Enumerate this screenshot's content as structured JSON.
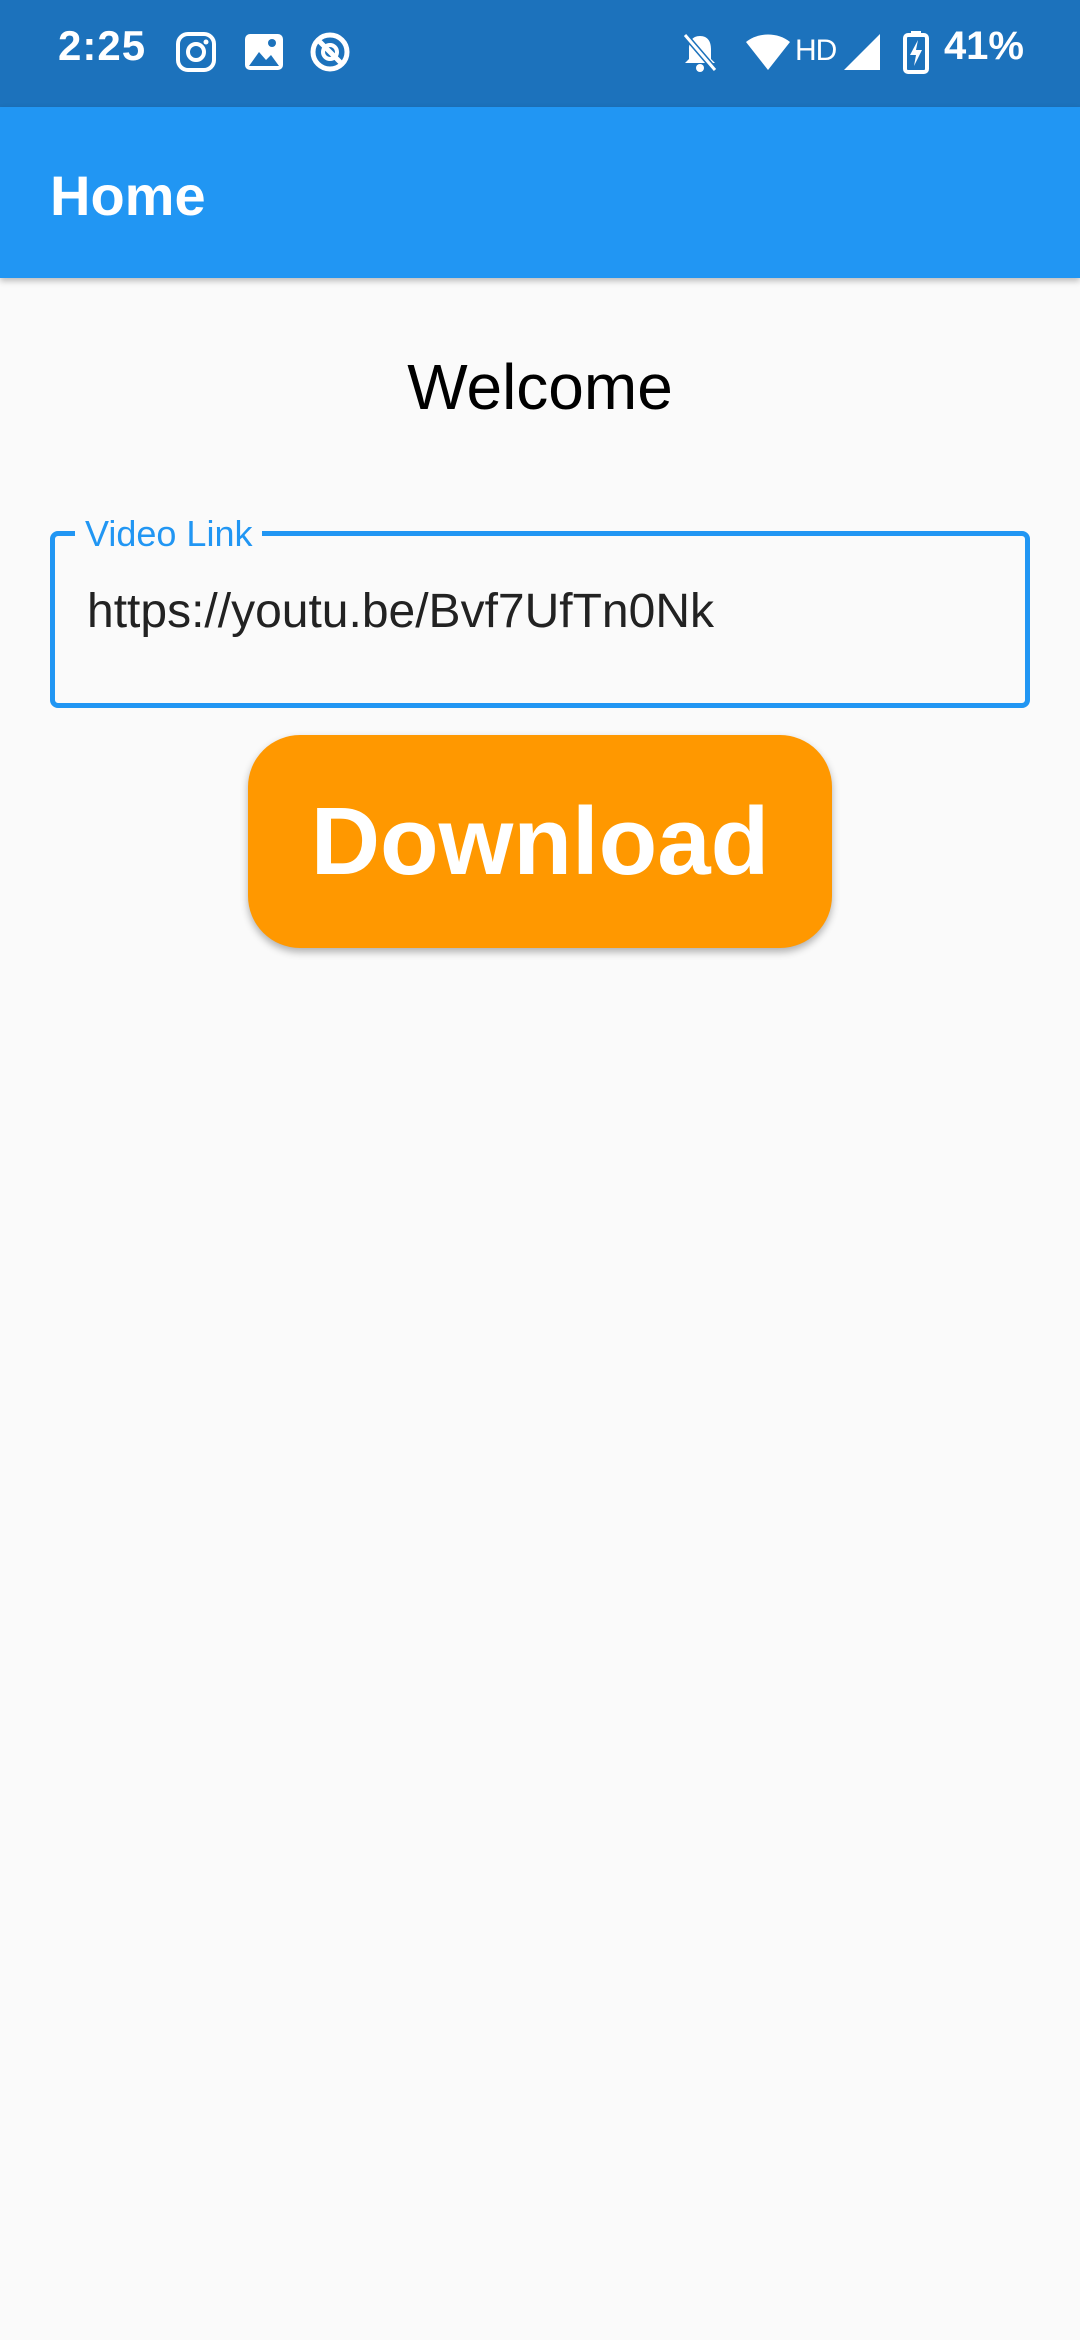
{
  "status_bar": {
    "time": "2:25",
    "network_label": "HD",
    "battery_percent": "41%",
    "icons": [
      "instagram-icon",
      "gallery-icon",
      "sync-icon",
      "notifications-off-icon",
      "wifi-icon",
      "signal-icon",
      "battery-charging-icon"
    ]
  },
  "app_bar": {
    "title": "Home"
  },
  "main": {
    "welcome_text": "Welcome",
    "video_link": {
      "label": "Video Link",
      "value": "https://youtu.be/Bvf7UfTn0Nk"
    },
    "download_label": "Download"
  },
  "colors": {
    "status_bar": "#1c72bc",
    "app_bar": "#2196f3",
    "accent": "#2196f3",
    "button": "#ff9800",
    "background": "#fafafa"
  }
}
